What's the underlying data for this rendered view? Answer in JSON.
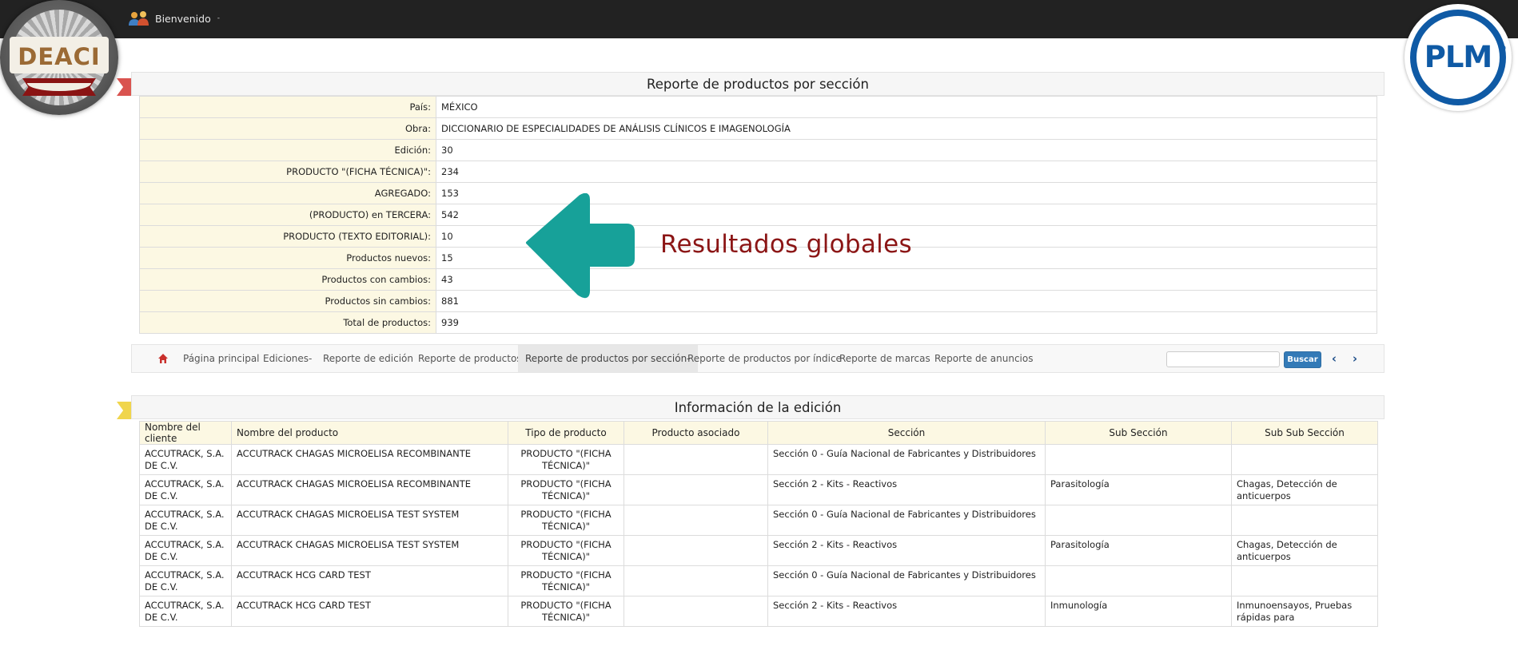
{
  "topbar": {
    "welcome_label": "Bienvenido",
    "caret": "-"
  },
  "logos": {
    "left": "DEACI",
    "right": "PLM",
    "right_mark": "®"
  },
  "summary": {
    "title": "Reporte de productos por sección",
    "rows": [
      {
        "label": "País:",
        "value": "MÉXICO"
      },
      {
        "label": "Obra:",
        "value": "DICCIONARIO DE ESPECIALIDADES DE ANÁLISIS CLÍNICOS E IMAGENOLOGÍA"
      },
      {
        "label": "Edición:",
        "value": "30"
      },
      {
        "label": "PRODUCTO \"(FICHA TÉCNICA)\":",
        "value": "234"
      },
      {
        "label": "AGREGADO:",
        "value": "153"
      },
      {
        "label": "(PRODUCTO) en TERCERA:",
        "value": "542"
      },
      {
        "label": "PRODUCTO (TEXTO EDITORIAL):",
        "value": "10"
      },
      {
        "label": "Productos nuevos:",
        "value": "15"
      },
      {
        "label": "Productos con cambios:",
        "value": "43"
      },
      {
        "label": "Productos sin cambios:",
        "value": "881"
      },
      {
        "label": "Total de productos:",
        "value": "939"
      }
    ]
  },
  "overlay": {
    "text": "Resultados globales",
    "arrow_color": "#17a199",
    "text_color": "#8b1515"
  },
  "nav": {
    "items": [
      {
        "label": "Página principal"
      },
      {
        "label": "Ediciones"
      },
      {
        "label": "Reporte de edición"
      },
      {
        "label": "Reporte de productos"
      },
      {
        "label": "Reporte de productos por sección"
      },
      {
        "label": "Reporte de productos por índice"
      },
      {
        "label": "Reporte de marcas"
      },
      {
        "label": "Reporte de anuncios"
      }
    ],
    "dropdown_caret": "-",
    "search_value": "",
    "search_button": "Buscar",
    "prev": "‹",
    "next": "›"
  },
  "edition": {
    "title": "Información de la edición",
    "headers": [
      "Nombre del cliente",
      "Nombre del producto",
      "Tipo de producto",
      "Producto asociado",
      "Sección",
      "Sub Sección",
      "Sub Sub Sección"
    ],
    "rows": [
      {
        "client": "ACCUTRACK, S.A. DE C.V.",
        "product": "ACCUTRACK CHAGAS MICROELISA RECOMBINANTE",
        "type": "PRODUCTO \"(FICHA TÉCNICA)\"",
        "assoc": "",
        "section": "Sección 0 - Guía Nacional de Fabricantes y Distribuidores",
        "sub": "",
        "subsub": ""
      },
      {
        "client": "ACCUTRACK, S.A. DE C.V.",
        "product": "ACCUTRACK CHAGAS MICROELISA RECOMBINANTE",
        "type": "PRODUCTO \"(FICHA TÉCNICA)\"",
        "assoc": "",
        "section": "Sección 2 - Kits - Reactivos",
        "sub": "Parasitología",
        "subsub": "Chagas, Detección de anticuerpos"
      },
      {
        "client": "ACCUTRACK, S.A. DE C.V.",
        "product": "ACCUTRACK CHAGAS MICROELISA TEST SYSTEM",
        "type": "PRODUCTO \"(FICHA TÉCNICA)\"",
        "assoc": "",
        "section": "Sección 0 - Guía Nacional de Fabricantes y Distribuidores",
        "sub": "",
        "subsub": ""
      },
      {
        "client": "ACCUTRACK, S.A. DE C.V.",
        "product": "ACCUTRACK CHAGAS MICROELISA TEST SYSTEM",
        "type": "PRODUCTO \"(FICHA TÉCNICA)\"",
        "assoc": "",
        "section": "Sección 2 - Kits - Reactivos",
        "sub": "Parasitología",
        "subsub": "Chagas, Detección de anticuerpos"
      },
      {
        "client": "ACCUTRACK, S.A. DE C.V.",
        "product": "ACCUTRACK HCG CARD TEST",
        "type": "PRODUCTO \"(FICHA TÉCNICA)\"",
        "assoc": "",
        "section": "Sección 0 - Guía Nacional de Fabricantes y Distribuidores",
        "sub": "",
        "subsub": ""
      },
      {
        "client": "ACCUTRACK, S.A. DE C.V.",
        "product": "ACCUTRACK HCG CARD TEST",
        "type": "PRODUCTO \"(FICHA TÉCNICA)\"",
        "assoc": "",
        "section": "Sección 2 - Kits - Reactivos",
        "sub": "Inmunología",
        "subsub": "Inmunoensayos, Pruebas rápidas para"
      }
    ]
  },
  "colors": {
    "topbar": "#222222",
    "label_bg": "#fcf8e3",
    "button": "#337ab7",
    "home_icon": "#c9302c"
  }
}
